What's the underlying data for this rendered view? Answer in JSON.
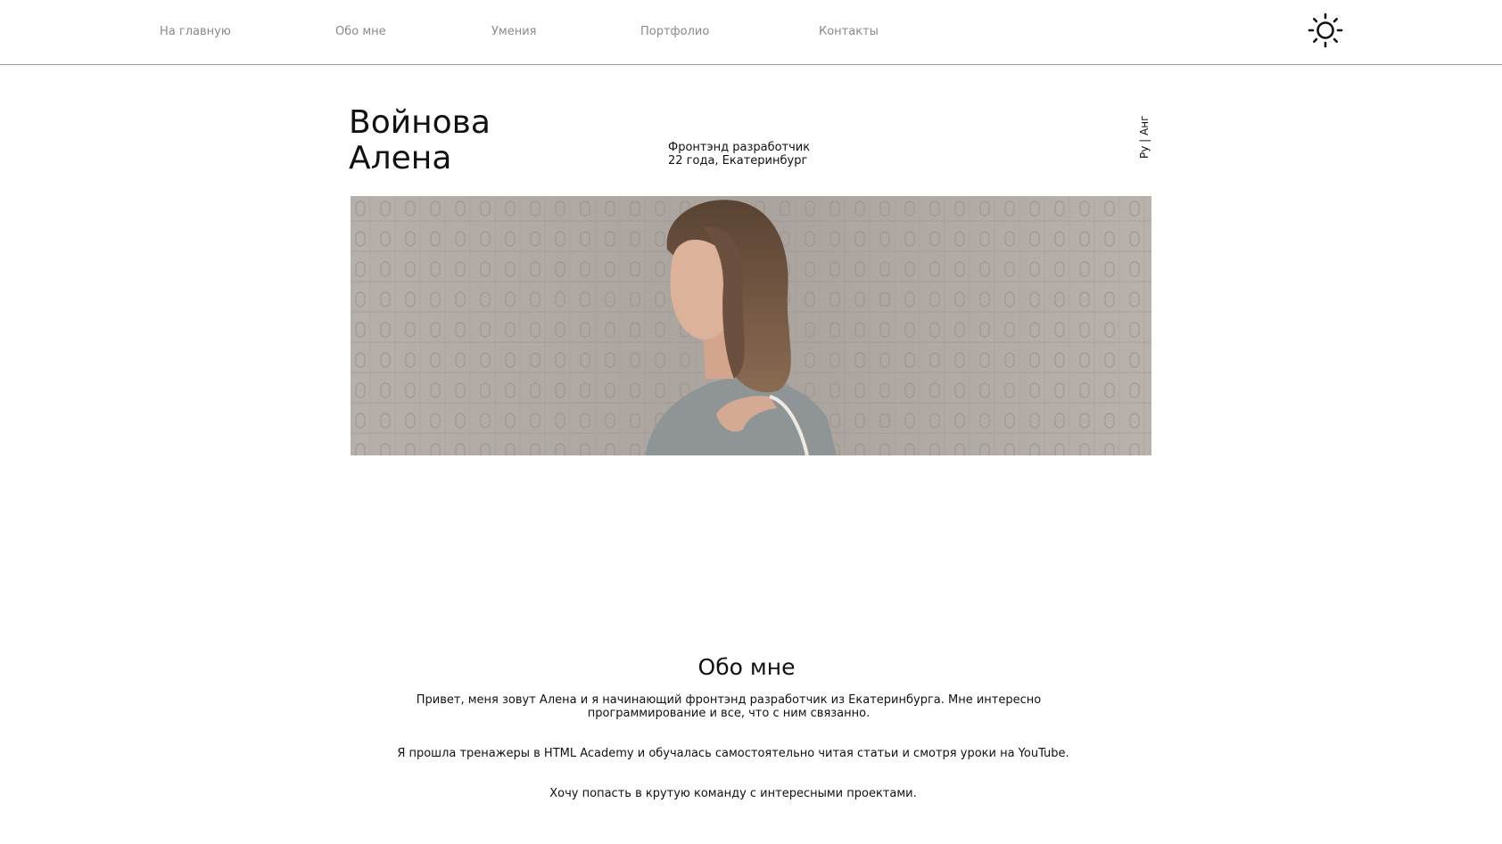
{
  "nav": {
    "items": [
      {
        "label": "На главную"
      },
      {
        "label": "Обо мне"
      },
      {
        "label": "Умения"
      },
      {
        "label": "Портфолио"
      },
      {
        "label": "Контакты"
      }
    ],
    "theme_icon": "sun-icon"
  },
  "hero": {
    "last_name": "Войнова",
    "first_name": "Алена",
    "role": "Фронтэнд разработчик",
    "age_city": "22 года, Екатеринбург",
    "lang_switch": "Ру | Анг",
    "photo_icon": "portrait-photo"
  },
  "about": {
    "title": "Обо мне",
    "paragraphs": [
      "Привет, меня зовут Алена и я начинающий фронтэнд разработчик из Екатеринбурга. Мне интересно программирование и все, что с ним связанно.",
      "Я прошла тренажеры в HTML Academy и обучалась самостоятельно читая статьи и смотря уроки на YouTube.",
      "Хочу попасть в крутую команду с интересными проектами."
    ]
  },
  "colors": {
    "text": "#111111",
    "nav_text": "#8a8a8a",
    "divider": "#9a9a9a",
    "background": "#ffffff"
  }
}
